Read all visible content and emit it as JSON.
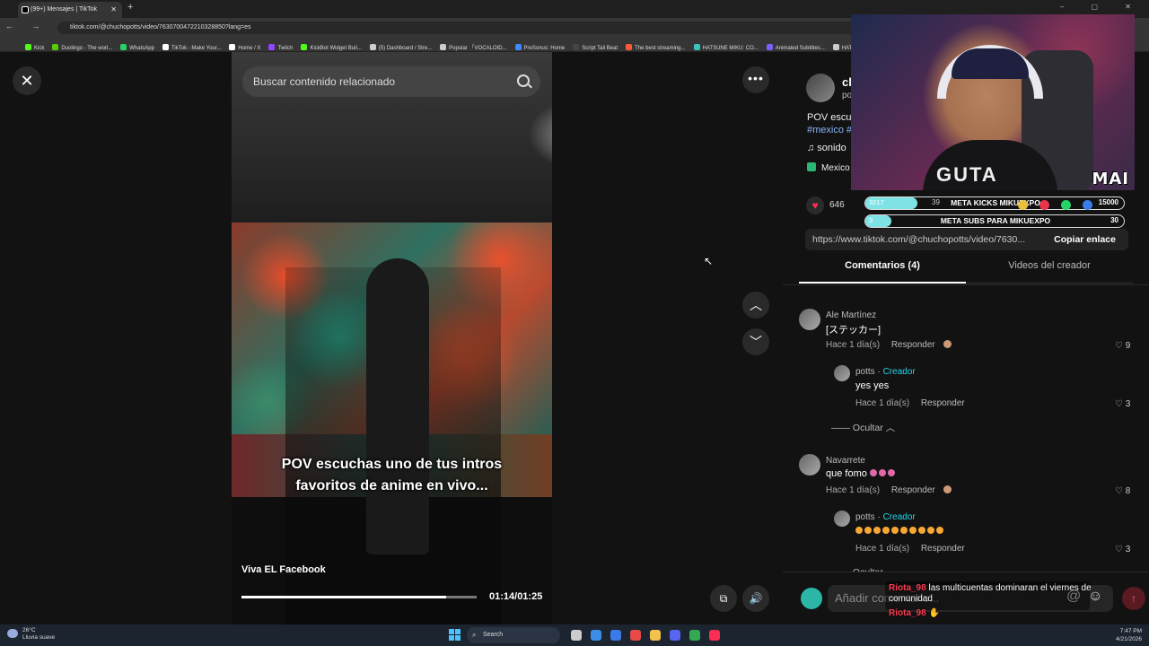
{
  "browser": {
    "tab_title": "(99+) Mensajes | TikTok",
    "new_tab": "+",
    "window_buttons": "– ▢ ✕",
    "nav": "← → ⟳",
    "url": "tiktok.com/@chuchopotts/video/7630700472210328850?lang=es",
    "bookmarks": [
      {
        "label": "Kick",
        "color": "#53fc18"
      },
      {
        "label": "Duolingo - The worl...",
        "color": "#58cc02"
      },
      {
        "label": "WhatsApp",
        "color": "#25d366"
      },
      {
        "label": "TikTok - Make Your...",
        "color": "#ffffff"
      },
      {
        "label": "Home / X",
        "color": "#ffffff"
      },
      {
        "label": "Twitch",
        "color": "#9146ff"
      },
      {
        "label": "KickBot Widget Buil...",
        "color": "#53fc18"
      },
      {
        "label": "(5) Dashboard / Stre...",
        "color": "#cccccc"
      },
      {
        "label": "Popular 「VOCALOID...",
        "color": "#cccccc"
      },
      {
        "label": "PreSonus: Home",
        "color": "#3d8bff"
      },
      {
        "label": "Script Tail Beat",
        "color": "#444444"
      },
      {
        "label": "The best streaming...",
        "color": "#ff5a36"
      },
      {
        "label": "HATSUNE MIKU: CO...",
        "color": "#39c5bb"
      },
      {
        "label": "Animated Subtitles...",
        "color": "#7b61ff"
      },
      {
        "label": "HATS",
        "color": "#cccccc"
      }
    ]
  },
  "video": {
    "close": "✕",
    "search_placeholder": "Buscar contenido relacionado",
    "caption_line1": "POV escuchas uno de tus intros",
    "caption_line2": "favoritos de anime en vivo...",
    "account_label": "Viva EL Facebook",
    "time": "01:14/01:25",
    "progress": 0.87,
    "more": "•••",
    "up": "︿",
    "down": "﹀",
    "pip": "⧉",
    "volume": "🔊"
  },
  "panel": {
    "creator_name": "cl",
    "creator_handle": "po",
    "description": "POV escuc",
    "hashtags": "#mexico #",
    "sound": "♫  sonido",
    "place": "Mexico",
    "likes": "646",
    "link_url": "https://www.tiktok.com/@chuchopotts/video/7630...",
    "copy_label": "Copiar enlace",
    "tab_comments": "Comentarios (4)",
    "tab_videos": "Videos del creador"
  },
  "comments": [
    {
      "user": "Ale Martínez",
      "text": "[ステッカー]",
      "time": "Hace 1 día(s)",
      "reply": "Responder",
      "likes": "9",
      "replies": [
        {
          "user": "potts",
          "creator": "Creador",
          "text": "yes yes",
          "time": "Hace 1 día(s)",
          "reply": "Responder",
          "likes": "3"
        }
      ]
    },
    {
      "user": "Navarrete",
      "text": "que fomo",
      "time": "Hace 1 día(s)",
      "reply": "Responder",
      "likes": "8",
      "replies": [
        {
          "user": "potts",
          "creator": "Creador",
          "text": "",
          "time": "Hace 1 día(s)",
          "reply": "Responder",
          "likes": "3"
        }
      ]
    }
  ],
  "hide_label": "Ocultar",
  "add_comment_placeholder": "Añadir comentario...",
  "stream": {
    "brand": "MAI",
    "shirt": "GUTA",
    "goal1": {
      "current": "3217",
      "label": "META KICKS MIKUEXPO",
      "mid": "39",
      "target": "15000",
      "fill": 0.2
    },
    "goal2": {
      "current": "3",
      "label": "META SUBS PARA MIKUEXPO",
      "target": "30",
      "fill": 0.1
    },
    "chat": [
      {
        "user": "Riota_98",
        "text": "las multicuentas dominaran el viernes de comunidad"
      },
      {
        "user": "Riota_98",
        "text": ""
      }
    ]
  },
  "taskbar": {
    "temp": "26°C",
    "weather": "Lluvia suave",
    "search": "Search",
    "time": "7:47 PM",
    "date": "4/21/2026"
  }
}
